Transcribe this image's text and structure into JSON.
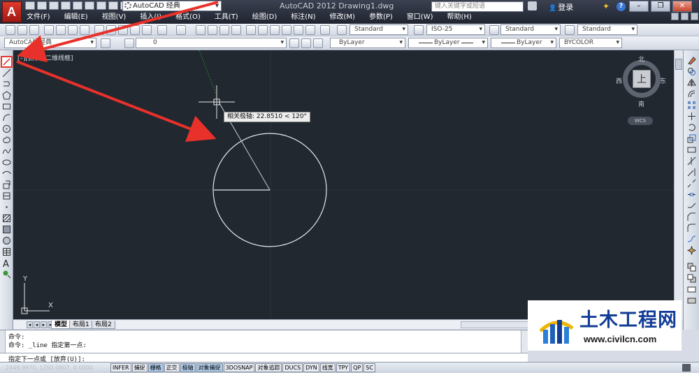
{
  "window": {
    "app_letter": "A",
    "workspace": "AutoCAD 经典",
    "title": "AutoCAD 2012    Drawing1.dwg",
    "search_placeholder": "键入关键字或短语",
    "login": "登录",
    "help": "?",
    "minimize": "–",
    "restore": "❐",
    "close": "✕"
  },
  "menu": {
    "items": [
      "文件(F)",
      "编辑(E)",
      "视图(V)",
      "插入(I)",
      "格式(O)",
      "工具(T)",
      "绘图(D)",
      "标注(N)",
      "修改(M)",
      "参数(P)",
      "窗口(W)",
      "帮助(H)"
    ]
  },
  "toolbar1": {
    "text_style": "Standard",
    "dim_style": "ISO-25",
    "table_style": "Standard",
    "mleader_style": "Standard"
  },
  "toolbar2": {
    "workspace": "AutoCAD 经典",
    "layer": "0",
    "color": "ByLayer",
    "linetype": "ByLayer",
    "lineweight": "ByLayer",
    "plotstyle": "BYCOLOR"
  },
  "canvas": {
    "viewport_label": "[–][俯视][二维线框]",
    "tooltip": "相关极轴: 22.8510 < 120°",
    "ucs_x": "X",
    "ucs_y": "Y",
    "background_color": "#212830"
  },
  "viewcube": {
    "north": "北",
    "south": "南",
    "east": "东",
    "west": "西",
    "face": "上",
    "wcs": "WCS"
  },
  "tabs": {
    "items": [
      "模型",
      "布局1",
      "布局2"
    ]
  },
  "command": {
    "line1": "命令:",
    "line2": "命令: _line 指定第一点:",
    "prompt": "指定下一点或 [放弃(U)]:"
  },
  "status": {
    "coords": "2449.9970, 1250.0807, 0.0000",
    "buttons": [
      "INFER",
      "捕捉",
      "栅格",
      "正交",
      "极轴",
      "对象捕捉",
      "3DOSNAP",
      "对象追踪",
      "DUCS",
      "DYN",
      "线宽",
      "TPY",
      "QP",
      "SC"
    ],
    "on_buttons": [
      "栅格",
      "极轴",
      "对象捕捉"
    ]
  },
  "watermark": {
    "title": "土木工程网",
    "url": "www.civilcn.com"
  },
  "colors": {
    "annotation_arrow": "#e8312a",
    "titlebar": "#2a2f3c",
    "watermark_text": "#123c96"
  }
}
